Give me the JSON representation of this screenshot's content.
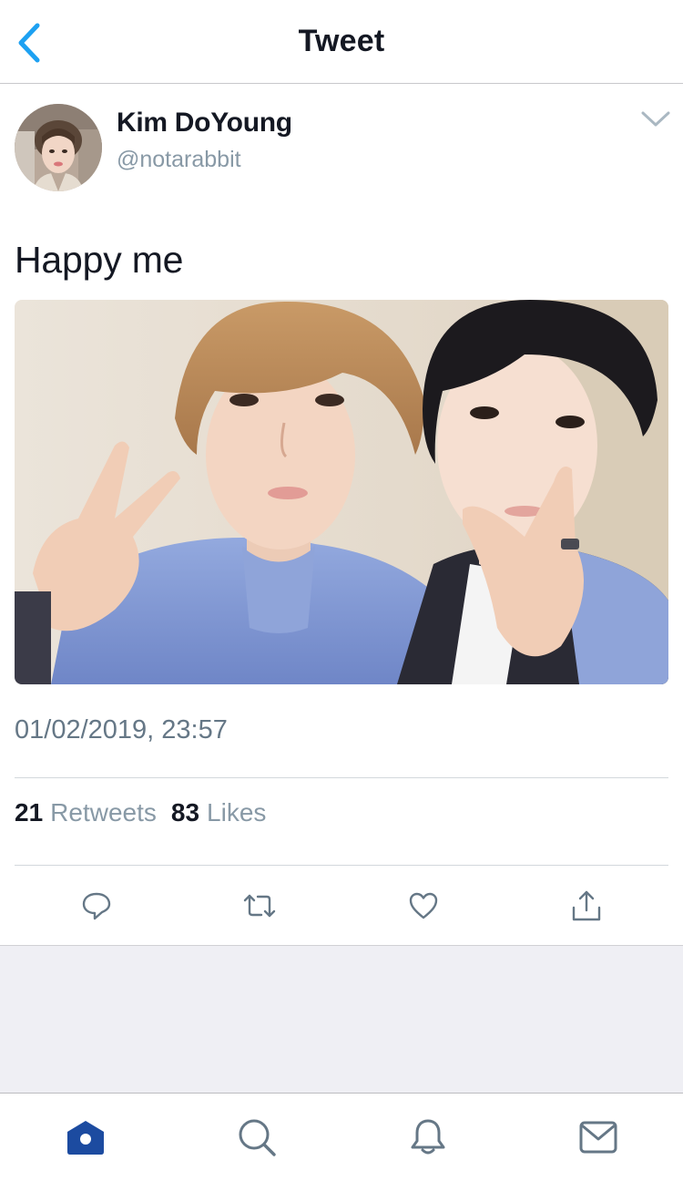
{
  "header": {
    "title": "Tweet",
    "back_icon": "chevron-left-icon"
  },
  "user": {
    "display_name": "Kim DoYoung",
    "handle": "@notarabbit"
  },
  "tweet": {
    "text": "Happy me",
    "timestamp": "01/02/2019, 23:57",
    "retweets_count": "21",
    "retweets_label": "Retweets",
    "likes_count": "83",
    "likes_label": "Likes"
  },
  "actions": [
    "reply-icon",
    "retweet-icon",
    "like-icon",
    "share-icon"
  ],
  "tabbar": {
    "tabs": [
      "home-icon",
      "search-icon",
      "notifications-icon",
      "messages-icon"
    ],
    "active": "home-icon"
  },
  "colors": {
    "accent": "#1da1f2",
    "nav_active": "#1c4ba0",
    "action_icon": "#657786",
    "secondary_text": "#8899a6"
  }
}
